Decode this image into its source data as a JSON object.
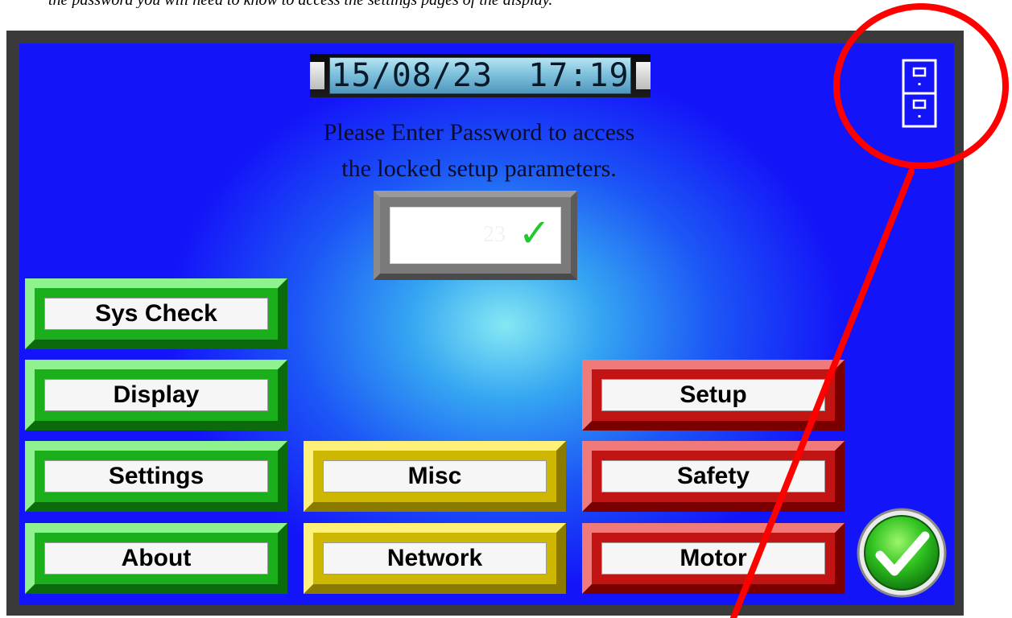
{
  "document": {
    "caption": "the password you will need to know to access the settings pages of the display."
  },
  "header": {
    "date": "15/08/23",
    "time": "17:19"
  },
  "prompt": {
    "line1": "Please Enter Password to access",
    "line2": "the locked setup parameters."
  },
  "password": {
    "value": "",
    "faint_text": "23",
    "confirm_glyph": "✓"
  },
  "buttons": {
    "sys_check": "Sys Check",
    "display": "Display",
    "settings": "Settings",
    "about": "About",
    "misc": "Misc",
    "network": "Network",
    "setup": "Setup",
    "safety": "Safety",
    "motor": "Motor"
  },
  "icons": {
    "top_right": "cabinet-drawer-icon",
    "bottom_right": "green-checkmark-ok-icon"
  },
  "colors": {
    "screen_blue": "#1414f8",
    "green_group": "#1bb01b",
    "yellow_group": "#cdb700",
    "red_group": "#c31414",
    "annotation": "#ff0000"
  }
}
